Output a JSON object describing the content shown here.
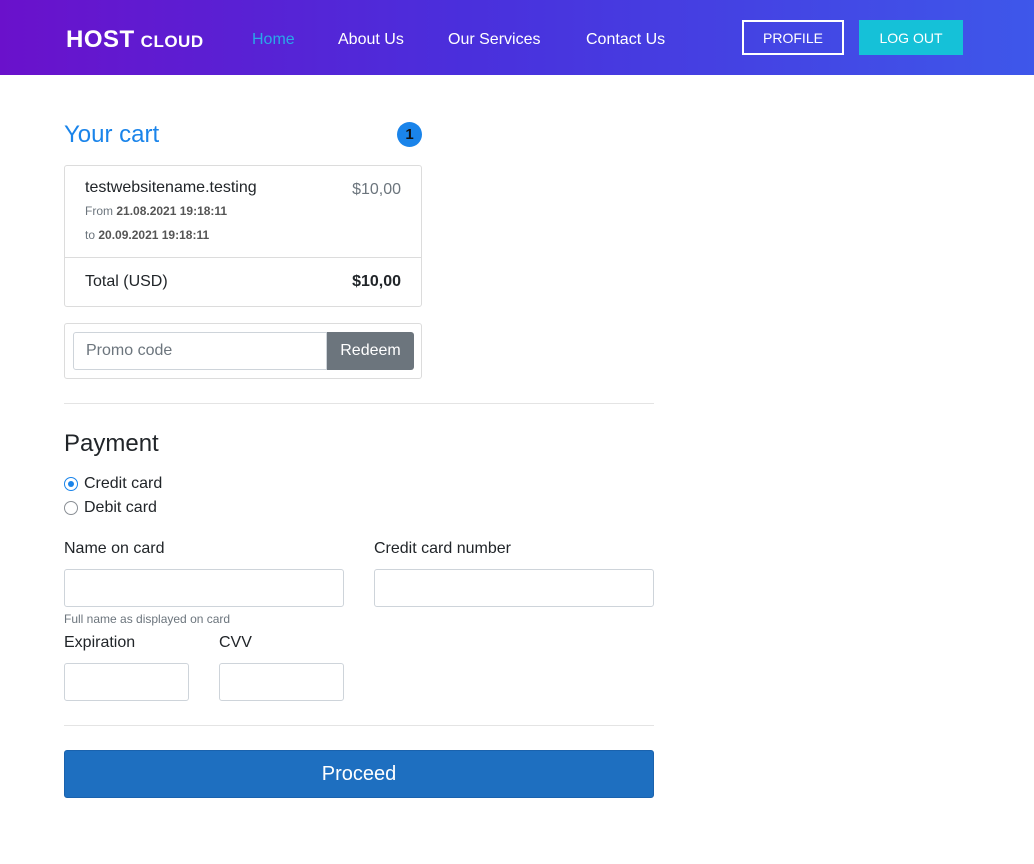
{
  "header": {
    "brand_main": "HOST",
    "brand_sub": "CLOUD",
    "nav": [
      "Home",
      "About Us",
      "Our Services",
      "Contact Us"
    ],
    "active_nav": "Home",
    "profile_label": "PROFILE",
    "logout_label": "LOG OUT"
  },
  "cart": {
    "title": "Your cart",
    "count": "1",
    "items": [
      {
        "name": "testwebsitename.testing",
        "price": "$10,00",
        "from_label": "From",
        "from_date": "21.08.2021 19:18:11",
        "to_label": "to",
        "to_date": "20.09.2021 19:18:11"
      }
    ],
    "total_label": "Total (USD)",
    "total_value": "$10,00"
  },
  "promo": {
    "placeholder": "Promo code",
    "value": "",
    "button_label": "Redeem"
  },
  "payment": {
    "title": "Payment",
    "methods": [
      {
        "label": "Credit card",
        "checked": true
      },
      {
        "label": "Debit card",
        "checked": false
      }
    ],
    "name_label": "Name on card",
    "name_value": "",
    "name_help": "Full name as displayed on card",
    "number_label": "Credit card number",
    "number_value": "",
    "expiration_label": "Expiration",
    "expiration_value": "",
    "cvv_label": "CVV",
    "cvv_value": ""
  },
  "proceed_label": "Proceed",
  "colors": {
    "accent": "#1a84ea",
    "header_start": "#6a11cb",
    "header_end": "#3e57ea",
    "logout_bg": "#15c1d8",
    "redeem_bg": "#6c757d",
    "proceed_bg": "#1e6fc0"
  }
}
